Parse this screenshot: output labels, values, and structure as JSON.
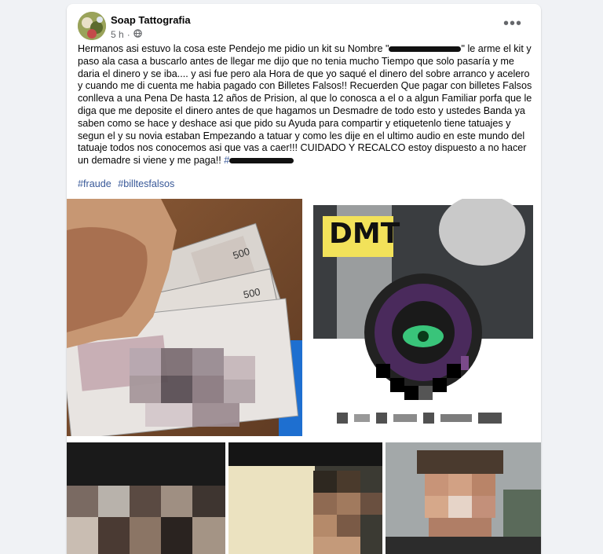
{
  "post": {
    "author": "Soap Tattografia",
    "time": "5 h",
    "dot": "·",
    "more_label": "•••",
    "text": {
      "p1": "Hermanos asi estuvo la cosa este Pendejo me pidio un kit su Nombre \"",
      "p2": "\" le arme el kit y paso ala casa a buscarlo antes de llegar me dijo que no tenia mucho Tiempo que solo pasaría y me daria el dinero y se iba.... y asi fue pero ala Hora de que yo saqué el dinero del sobre arranco y acelero y cuando me di cuenta me habia pagado con Billetes Falsos!! Recuerden Que pagar con billetes Falsos conlleva a una Pena De hasta 12 años de Prision, al que lo conosca a el o a algun Familiar porfa que le diga que me deposite el dinero antes de que hagamos un Desmadre de todo esto y ustedes Banda ya saben como se hace y deshace asi que pido su Ayuda para compartir y etiquetenlo tiene tatuajes y segun el y su novia estaban Empezando a tatuar y como les dije en el ultimo audio en este mundo del tatuaje todos nos conocemos asi que vas a caer!!! CUIDADO Y RECALCO  estoy dispuesto a no hacer un demadre si viene y me paga!! ",
      "p3": "#"
    },
    "hashtags": [
      "#fraude",
      "#billtesfalsos"
    ]
  },
  "photos": {
    "dmt_text": "DMT"
  },
  "colors": {
    "background": "#f0f2f5",
    "card": "#ffffff",
    "link": "#385898",
    "muted": "#65676b"
  },
  "icons": {
    "privacy": "globe-icon",
    "menu": "more-options-icon"
  }
}
